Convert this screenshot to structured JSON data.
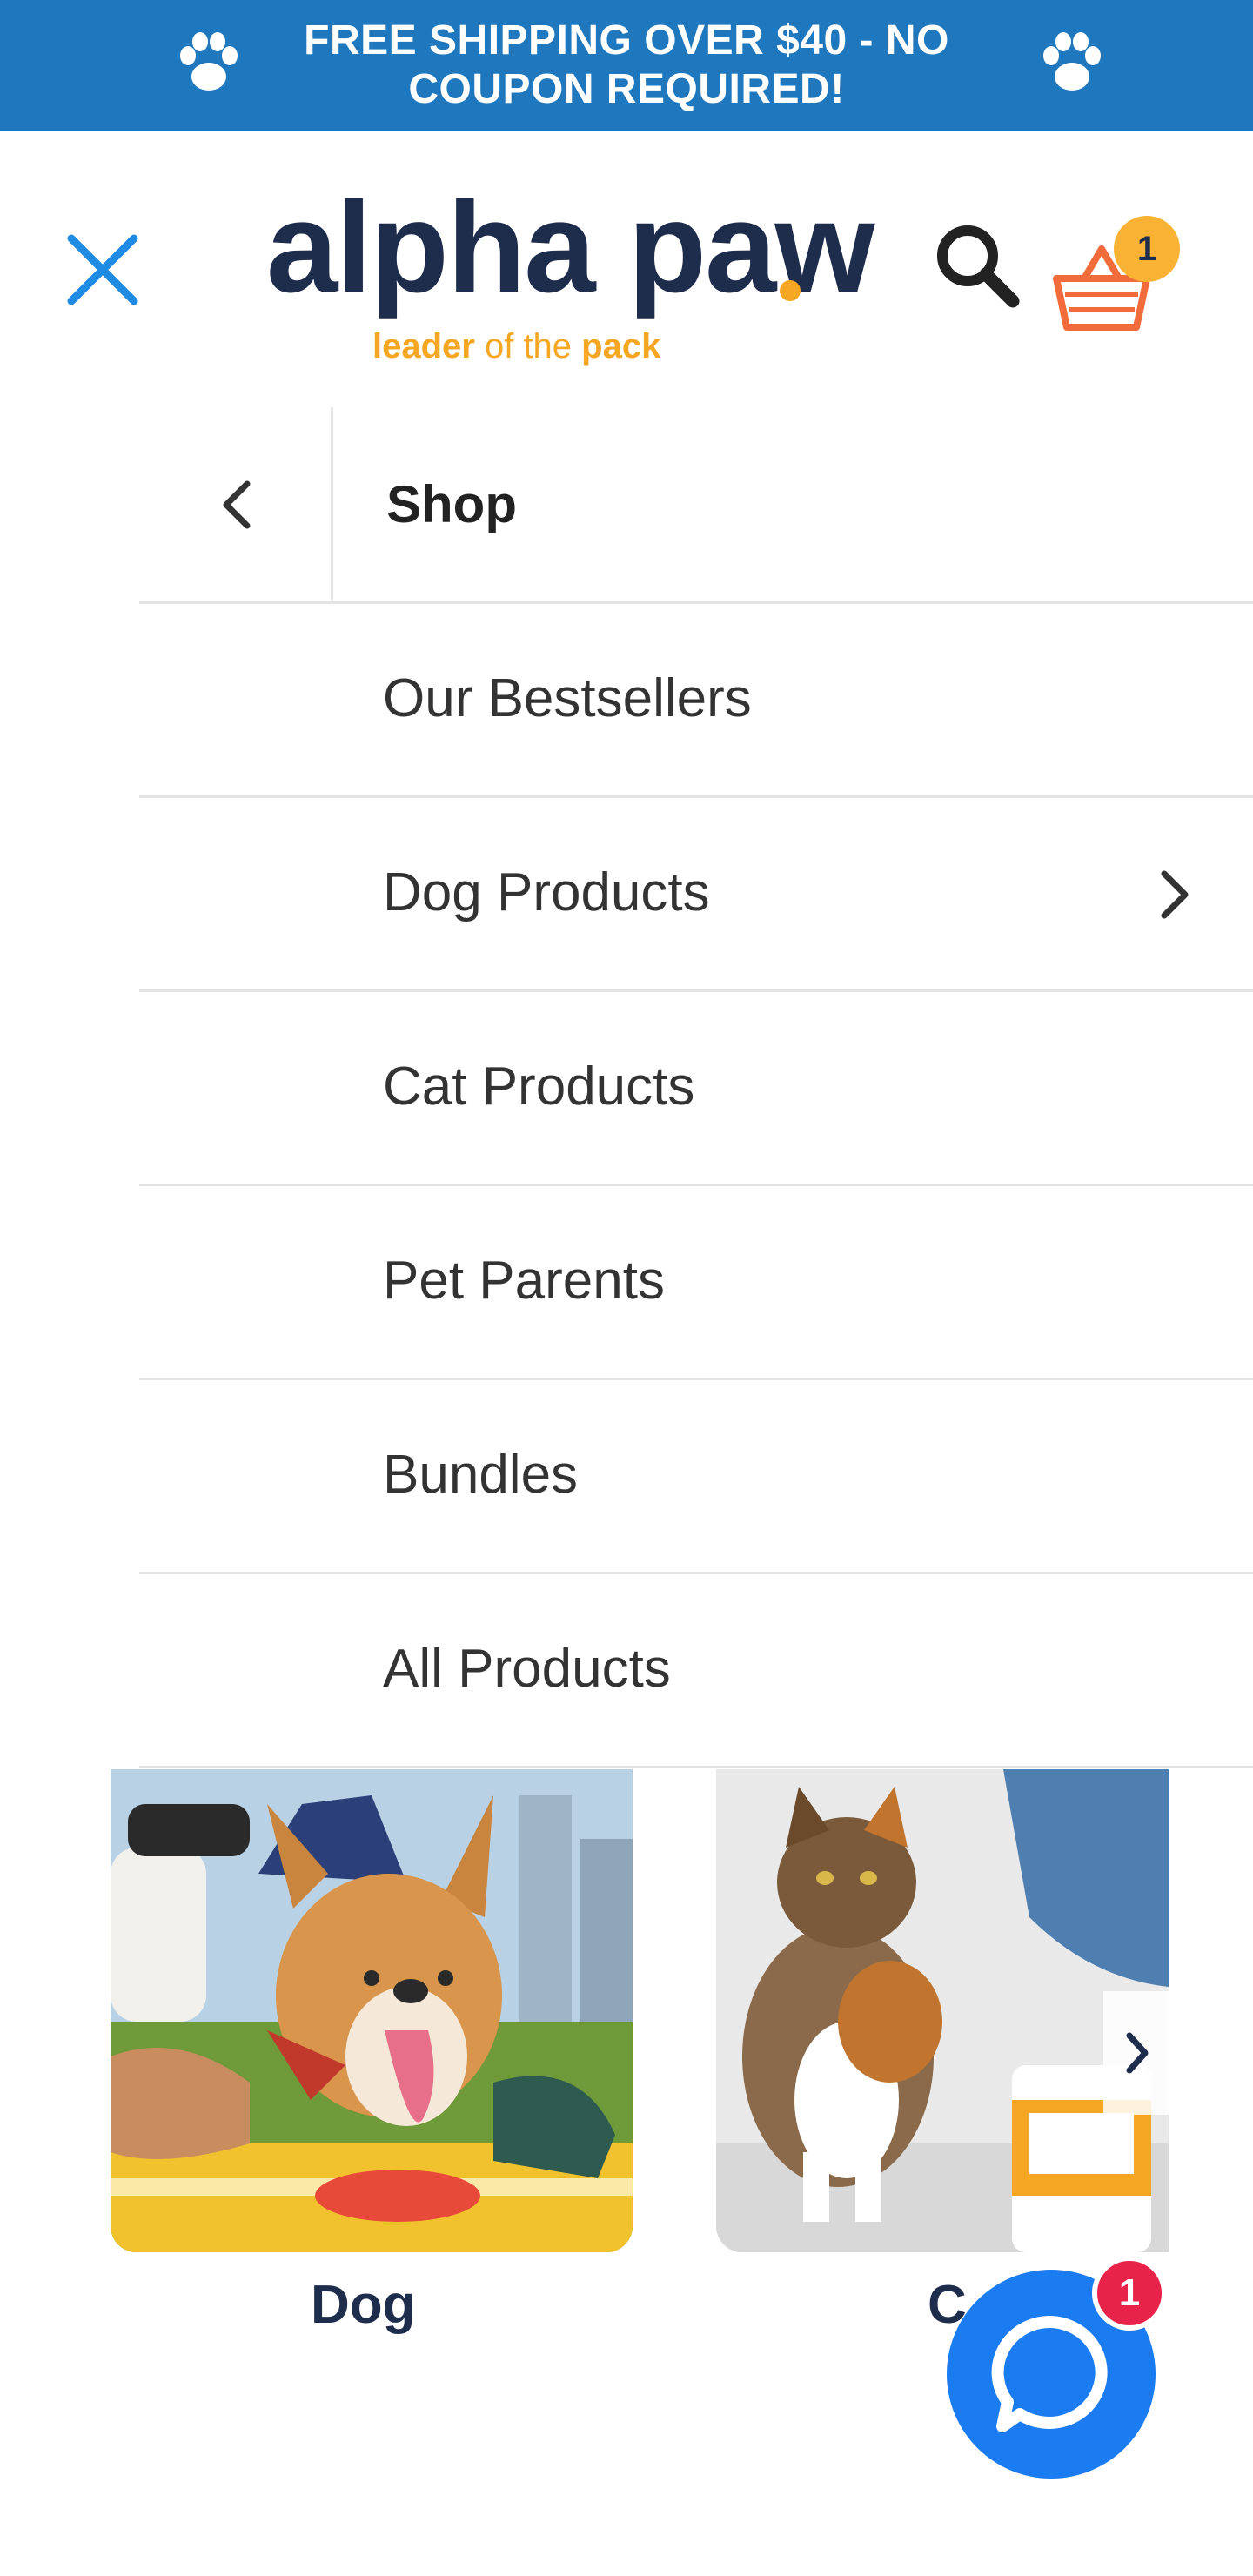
{
  "announcement": {
    "text": "FREE SHIPPING OVER $40 - NO COUPON REQUIRED!"
  },
  "brand": {
    "name": "alpha paw",
    "tagline_prefix": "leader",
    "tagline_middle": " of the ",
    "tagline_suffix": "pack"
  },
  "header": {
    "close_icon": "close-icon",
    "search_icon": "search-icon",
    "cart_icon": "basket-icon",
    "cart_count": "1"
  },
  "menu": {
    "title": "Shop",
    "back_icon": "chevron-left-icon",
    "items": [
      {
        "label": "Our Bestsellers",
        "has_submenu": false
      },
      {
        "label": "Dog Products",
        "has_submenu": true
      },
      {
        "label": "Cat Products",
        "has_submenu": false
      },
      {
        "label": "Pet Parents",
        "has_submenu": false
      },
      {
        "label": "Bundles",
        "has_submenu": false
      },
      {
        "label": "All Products",
        "has_submenu": false
      }
    ]
  },
  "categories": [
    {
      "label": "Dog",
      "image": "corgi at picnic with water bottle and bowl"
    },
    {
      "label": "C",
      "image": "calico cat with L-Lysine supplement jar"
    }
  ],
  "chat": {
    "icon": "chat-bubble-icon",
    "badge": "1"
  },
  "colors": {
    "announcement_bg": "#1f78bd",
    "brand_navy": "#1f2d4d",
    "brand_orange": "#f5a623",
    "cart_orange": "#f26b3a",
    "chat_blue": "#1a7cf0",
    "badge_red": "#e8234a"
  }
}
